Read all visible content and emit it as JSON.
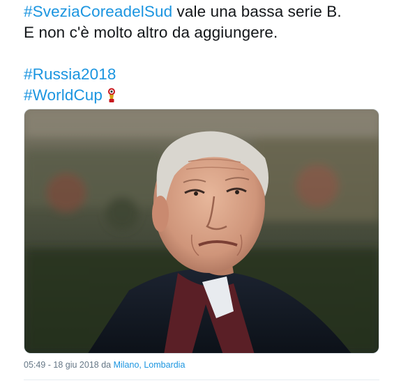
{
  "tweet": {
    "line1": {
      "hashtag": "#SveziaCoreadelSud",
      "text": " vale una bassa serie B."
    },
    "line2": "E non c'è molto altro da aggiungere.",
    "hashtags": [
      "#Russia2018",
      "#WorldCup"
    ],
    "emoji": "world-cup-trophy-icon"
  },
  "media": {
    "alt_subject": "man-in-dark-coat-photo"
  },
  "meta": {
    "time_date": "05:49 - 18 giu 2018 da ",
    "location": "Milano, Lombardia"
  },
  "colors": {
    "link": "#1b95e0",
    "text": "#14171a",
    "meta": "#657786"
  }
}
